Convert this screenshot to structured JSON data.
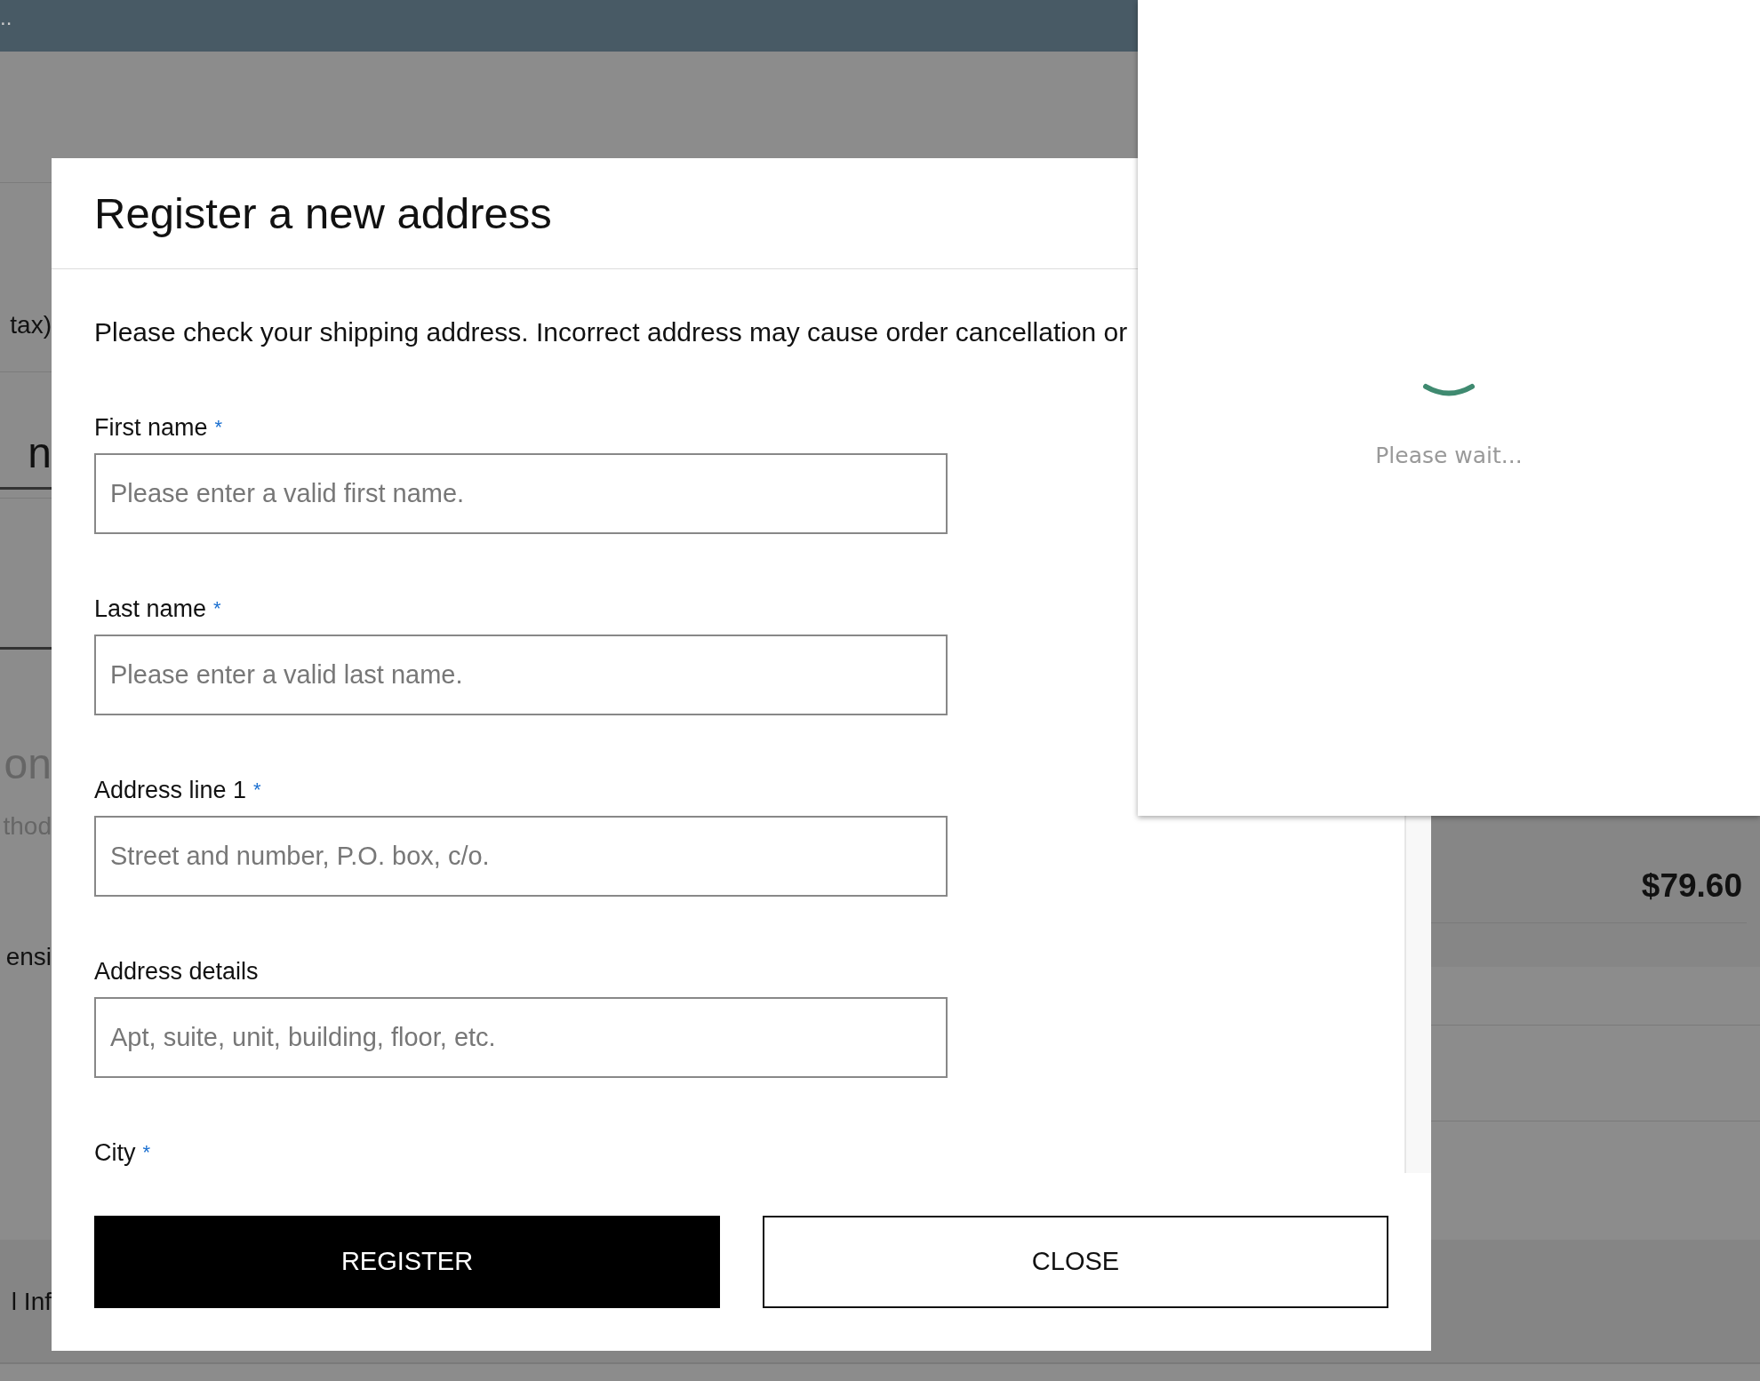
{
  "background_page": {
    "top_bar_text": "..",
    "left_texts": [
      {
        "text": "tax)",
        "kind": "body"
      },
      {
        "text": "n",
        "kind": "heading"
      },
      {
        "text": "on",
        "kind": "heading_muted"
      },
      {
        "text": "thod",
        "kind": "muted"
      },
      {
        "text": "ensi",
        "kind": "body"
      },
      {
        "text": "l Inf",
        "kind": "body"
      }
    ],
    "summary_total": "$79.60"
  },
  "modal": {
    "title": "Register a new address",
    "notice": "Please check your shipping address. Incorrect address may cause order cancellation or",
    "fields": [
      {
        "label": "First name",
        "required_mark": "*",
        "placeholder": "Please enter a valid first name."
      },
      {
        "label": "Last name",
        "required_mark": "*",
        "placeholder": "Please enter a valid last name."
      },
      {
        "label": "Address line 1",
        "required_mark": "*",
        "placeholder": "Street and number, P.O. box, c/o."
      },
      {
        "label": "Address details",
        "placeholder": "Apt, suite, unit, building, floor, etc."
      },
      {
        "label": "City",
        "required_mark": "*"
      }
    ],
    "buttons": [
      {
        "label": "REGISTER",
        "kind": "primary"
      },
      {
        "label": "CLOSE",
        "kind": "secondary"
      }
    ]
  },
  "loading_popup": {
    "message": "Please wait..."
  }
}
